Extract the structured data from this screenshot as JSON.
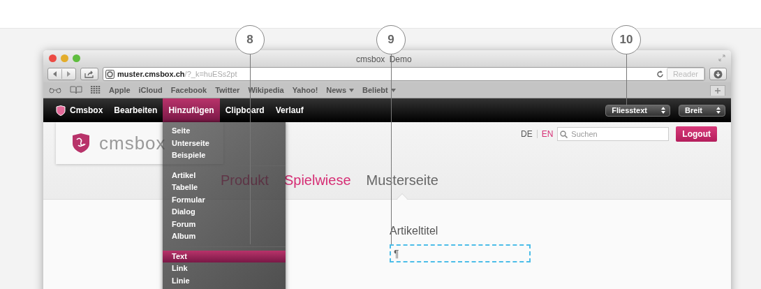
{
  "callouts": [
    {
      "number": "8",
      "kind": "long"
    },
    {
      "number": "9",
      "kind": "long"
    },
    {
      "number": "10",
      "kind": "short"
    }
  ],
  "window": {
    "title": "cmsbox Demo"
  },
  "address_bar": {
    "host": "muster.cmsbox.ch",
    "path": "/?_k=huESs2pt",
    "reader_button": "Reader"
  },
  "bookmarks": [
    {
      "label": "Apple",
      "has_menu": false
    },
    {
      "label": "iCloud",
      "has_menu": false
    },
    {
      "label": "Facebook",
      "has_menu": false
    },
    {
      "label": "Twitter",
      "has_menu": false
    },
    {
      "label": "Wikipedia",
      "has_menu": false
    },
    {
      "label": "Yahoo!",
      "has_menu": false
    },
    {
      "label": "News",
      "has_menu": true
    },
    {
      "label": "Beliebt",
      "has_menu": true
    }
  ],
  "cms_toolbar": {
    "items": [
      {
        "label": "Cmsbox",
        "kind": "brand",
        "selected": false
      },
      {
        "label": "Bearbeiten",
        "kind": "menu",
        "selected": false
      },
      {
        "label": "Hinzufügen",
        "kind": "menu",
        "selected": true
      },
      {
        "label": "Clipboard",
        "kind": "menu",
        "selected": false
      },
      {
        "label": "Verlauf",
        "kind": "menu",
        "selected": false
      }
    ],
    "selects": [
      {
        "label": "Fliesstext"
      },
      {
        "label": "Breit"
      }
    ]
  },
  "add_menu": {
    "groups": [
      {
        "items": [
          {
            "label": "Seite",
            "selected": false
          },
          {
            "label": "Unterseite",
            "selected": false
          },
          {
            "label": "Beispiele",
            "selected": false
          }
        ]
      },
      {
        "items": [
          {
            "label": "Artikel",
            "selected": false
          },
          {
            "label": "Tabelle",
            "selected": false
          },
          {
            "label": "Formular",
            "selected": false
          },
          {
            "label": "Dialog",
            "selected": false
          },
          {
            "label": "Forum",
            "selected": false
          },
          {
            "label": "Album",
            "selected": false
          }
        ]
      },
      {
        "items": [
          {
            "label": "Text",
            "selected": true
          },
          {
            "label": "Link",
            "selected": false
          },
          {
            "label": "Linie",
            "selected": false
          }
        ]
      }
    ]
  },
  "site": {
    "logo_text": "cmsbox",
    "languages": [
      {
        "label": "DE",
        "selected": false
      },
      {
        "label": "EN",
        "selected": true
      }
    ],
    "search": {
      "placeholder": "Suchen"
    },
    "logout_button": "Logout",
    "nav": [
      {
        "label": "Produkt",
        "selected": false
      },
      {
        "label": "Spielwiese",
        "selected": false
      },
      {
        "label": "Musterseite",
        "selected": true
      }
    ]
  },
  "article": {
    "title": "Artikeltitel",
    "paragraph_mark": "¶"
  }
}
